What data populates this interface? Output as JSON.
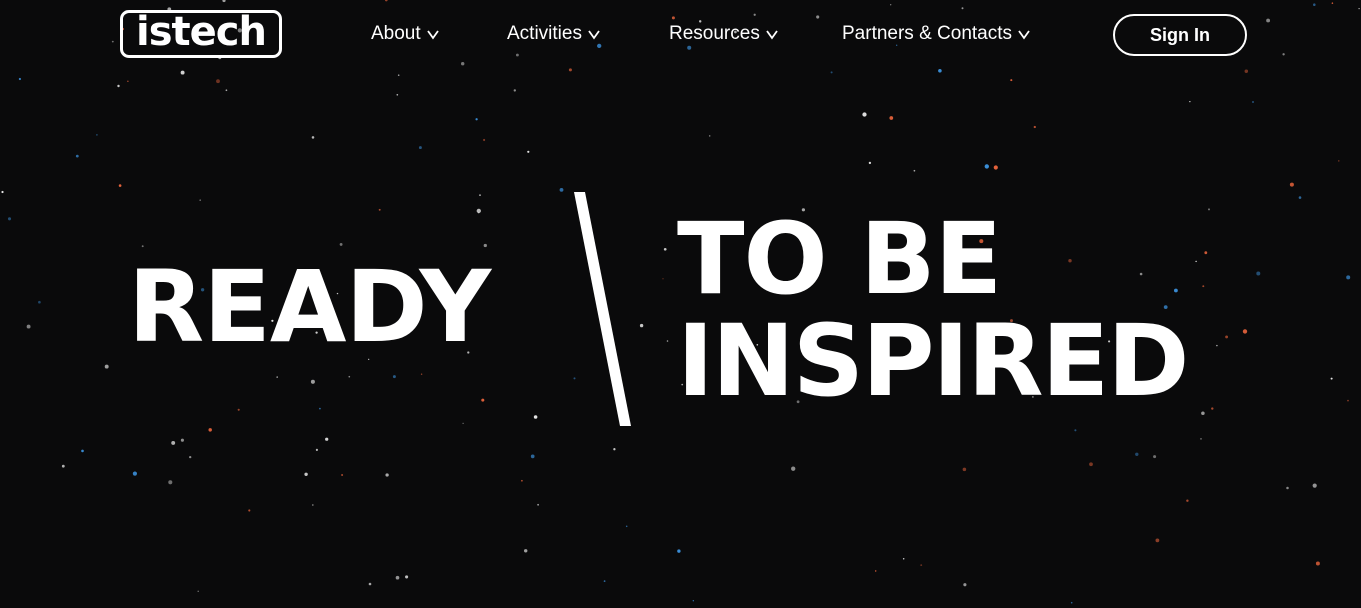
{
  "header": {
    "logo_text": "istech",
    "nav": [
      {
        "label": "About",
        "icon": "chevron-down-icon"
      },
      {
        "label": "Activities",
        "icon": "chevron-down-icon"
      },
      {
        "label": "Resources",
        "icon": "chevron-down-icon"
      },
      {
        "label": "Partners & Contacts",
        "icon": "chevron-down-icon"
      }
    ],
    "signin_label": "Sign In"
  },
  "hero": {
    "left": "READY",
    "right_line1": "TO BE",
    "right_line2": "INSPIRED"
  },
  "colors": {
    "background": "#0a0a0b",
    "text": "#ffffff",
    "star_white": "#e8e8e8",
    "star_blue": "#3b8fd9",
    "star_orange": "#e8643c"
  }
}
